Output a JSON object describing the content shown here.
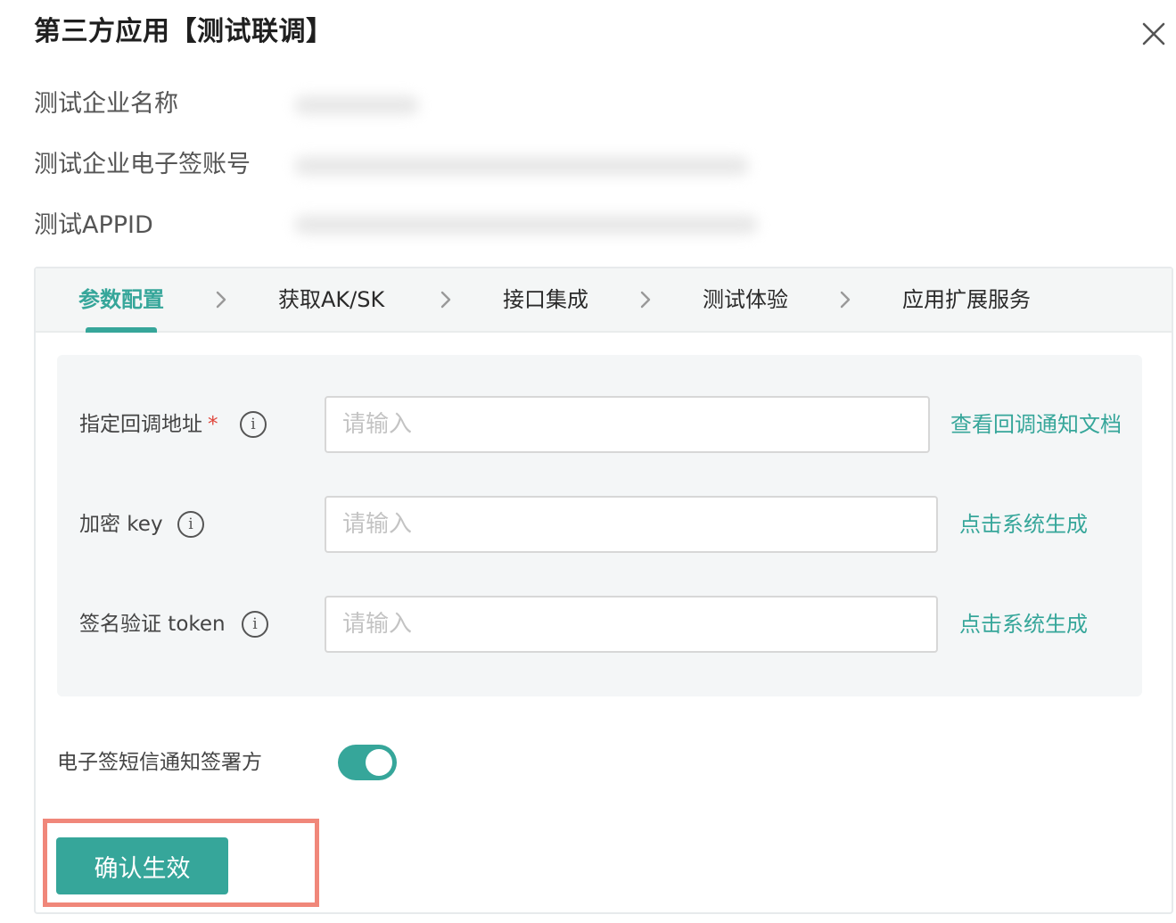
{
  "dialog": {
    "title": "第三方应用【测试联调】",
    "close_icon": "close-icon"
  },
  "info": {
    "company_name_label": "测试企业名称",
    "account_label": "测试企业电子签账号",
    "appid_label": "测试APPID"
  },
  "steps": [
    {
      "label": "参数配置",
      "active": true
    },
    {
      "label": "获取AK/SK",
      "active": false
    },
    {
      "label": "接口集成",
      "active": false
    },
    {
      "label": "测试体验",
      "active": false
    },
    {
      "label": "应用扩展服务",
      "active": false
    }
  ],
  "form": {
    "callback": {
      "label": "指定回调地址",
      "required_mark": "*",
      "placeholder": "请输入",
      "link": "查看回调通知文档"
    },
    "encrypt_key": {
      "label": "加密 key",
      "placeholder": "请输入",
      "link": "点击系统生成"
    },
    "sign_token": {
      "label": "签名验证 token",
      "placeholder": "请输入",
      "link": "点击系统生成"
    },
    "info_icon_glyph": "i"
  },
  "sms_notify": {
    "label": "电子签短信通知签署方",
    "enabled": true
  },
  "confirm_button": "确认生效",
  "colors": {
    "accent": "#36a69a",
    "highlight": "#f0877a",
    "required": "#e0453a"
  }
}
